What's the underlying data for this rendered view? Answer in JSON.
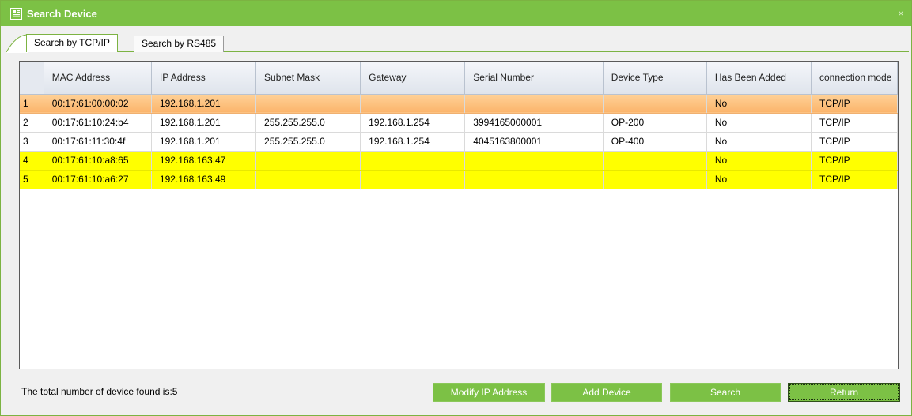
{
  "window": {
    "title": "Search Device",
    "close_glyph": "×",
    "icon": "search-device-icon",
    "accent_color": "#7cc145"
  },
  "tabs": [
    {
      "label": "Search by TCP/IP",
      "active": true
    },
    {
      "label": "Search by RS485",
      "active": false
    }
  ],
  "table": {
    "columns": [
      "",
      "MAC Address",
      "IP Address",
      "Subnet Mask",
      "Gateway",
      "Serial Number",
      "Device Type",
      "Has Been Added",
      "connection mode"
    ],
    "rows": [
      {
        "idx": "1",
        "mac": "00:17:61:00:00:02",
        "ip": "192.168.1.201",
        "mask": "",
        "gateway": "",
        "serial": "",
        "type": "",
        "added": "No",
        "mode": "TCP/IP",
        "style": "selected"
      },
      {
        "idx": "2",
        "mac": "00:17:61:10:24:b4",
        "ip": "192.168.1.201",
        "mask": "255.255.255.0",
        "gateway": "192.168.1.254",
        "serial": "3994165000001",
        "type": "OP-200",
        "added": "No",
        "mode": "TCP/IP",
        "style": "normal"
      },
      {
        "idx": "3",
        "mac": "00:17:61:11:30:4f",
        "ip": "192.168.1.201",
        "mask": "255.255.255.0",
        "gateway": "192.168.1.254",
        "serial": "4045163800001",
        "type": "OP-400",
        "added": "No",
        "mode": "TCP/IP",
        "style": "normal"
      },
      {
        "idx": "4",
        "mac": "00:17:61:10:a8:65",
        "ip": "192.168.163.47",
        "mask": "",
        "gateway": "",
        "serial": "",
        "type": "",
        "added": "No",
        "mode": "TCP/IP",
        "style": "highlight"
      },
      {
        "idx": "5",
        "mac": "00:17:61:10:a6:27",
        "ip": "192.168.163.49",
        "mask": "",
        "gateway": "",
        "serial": "",
        "type": "",
        "added": "No",
        "mode": "TCP/IP",
        "style": "highlight"
      }
    ]
  },
  "status": {
    "text": "The total number of device found is:5"
  },
  "buttons": {
    "modify": "Modify IP Address",
    "add": "Add Device",
    "search": "Search",
    "return": "Return"
  },
  "colors": {
    "selected_row": "#fbb46b",
    "highlight_row": "#ffff00",
    "button_bg": "#7cc145"
  }
}
